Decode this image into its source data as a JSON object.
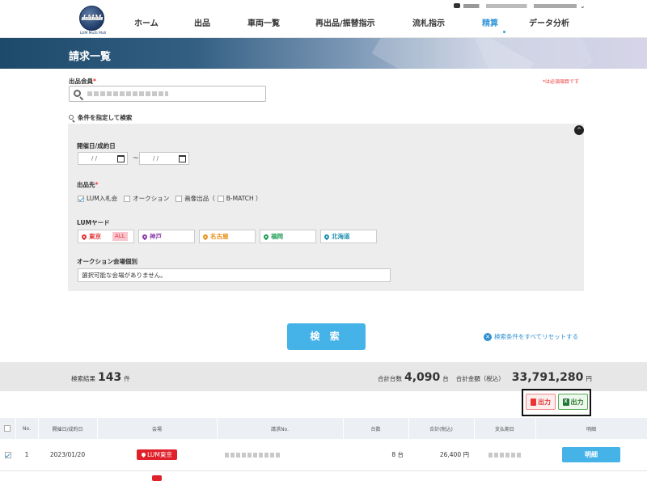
{
  "header": {
    "logo_mark": "LMM",
    "logo_text": "LUM Multi Mall",
    "nav": [
      "ホーム",
      "出品",
      "車両一覧",
      "再出品/振替指示",
      "流札指示",
      "精算",
      "データ分析"
    ],
    "active_nav": "精算"
  },
  "page": {
    "title": "請求一覧"
  },
  "member": {
    "label": "出品会員",
    "required_mark": "*",
    "required_note": "*は必須項目です"
  },
  "conditions": {
    "toggle_label": "条件を指定して検索",
    "date_label": "開催日/成約日",
    "date_from": "/  /",
    "date_to": "/  /",
    "tilde": "~",
    "dest_label": "出品先",
    "dest_options": [
      {
        "label": "LUM入札会",
        "checked": true
      },
      {
        "label": "オークション",
        "checked": false
      },
      {
        "label": "画像出品（",
        "checked": false
      },
      {
        "label": "B-MATCH ）",
        "checked": false
      }
    ],
    "yard_label": "LUMヤード",
    "yards": [
      {
        "label": "東京",
        "color": "#e33333"
      },
      {
        "label": "神戸",
        "color": "#8a3aa8"
      },
      {
        "label": "名古屋",
        "color": "#e8901a"
      },
      {
        "label": "福岡",
        "color": "#1f9a55"
      },
      {
        "label": "北海道",
        "color": "#1f8fb0"
      }
    ],
    "all_badge": "ALL",
    "venue_label": "オークション会場個別",
    "venue_value": "選択可能な会場がありません。"
  },
  "search": {
    "button": "検 索",
    "reset": "検索条件をすべてリセットする"
  },
  "results": {
    "count_label": "検索結果",
    "count": "143",
    "count_unit": "件",
    "units_label": "合計台数",
    "units": "4,090",
    "units_unit": "台",
    "amount_label": "合計金額（税込）",
    "amount": "33,791,280",
    "amount_unit": "円"
  },
  "export": {
    "pdf": "出力",
    "excel": "出力"
  },
  "table": {
    "headers": [
      "",
      "No.",
      "開催日/成約日",
      "会場",
      "請求No.",
      "台数",
      "合計(税込)",
      "支払期日",
      "明細"
    ],
    "rows": [
      {
        "no": "1",
        "date": "2023/01/20",
        "venue": "LUM東京",
        "units": "8 台",
        "total": "26,400 円",
        "detail": "明細"
      }
    ]
  }
}
